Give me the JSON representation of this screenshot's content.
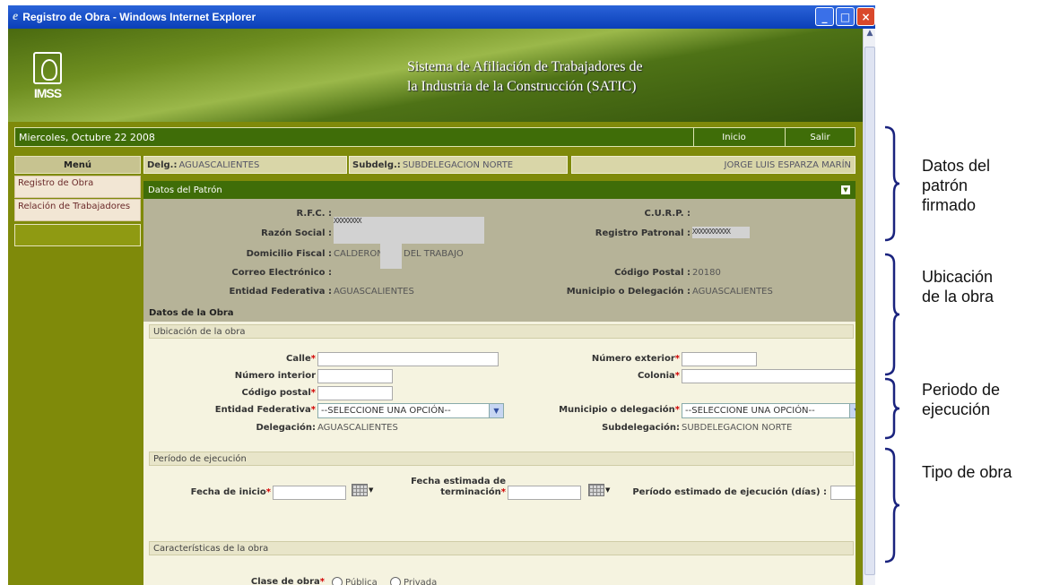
{
  "window": {
    "title": "Registro de Obra - Windows Internet Explorer"
  },
  "header": {
    "logo_text": "IMSS",
    "system_title_line1": "Sistema de Afiliación de Trabajadores de",
    "system_title_line2": "la Industria de la Construcción (SATIC)"
  },
  "topbar": {
    "date": "Miercoles, Octubre 22 2008",
    "inicio": "Inicio",
    "salir": "Salir"
  },
  "menu": {
    "title": "Menú",
    "items": [
      "Registro de Obra",
      "Relación de Trabajadores"
    ]
  },
  "info_bar": {
    "delg_label": "Delg.:",
    "delg_value": "AGUASCALIENTES",
    "subdelg_label": "Subdelg.:",
    "subdelg_value": "SUBDELEGACION NORTE",
    "user": "JORGE LUIS ESPARZA MARÍN"
  },
  "patron": {
    "section_title": "Datos del Patrón",
    "rfc_label": "R.F.C. :",
    "curp_label": "C.U.R.P. :",
    "razon_label": "Razón Social :",
    "razon_value": "XXXXXXXX",
    "registro_label": "Registro Patronal :",
    "registro_value": "XXXXXXXXXXX",
    "domicilio_label": "Domicilio Fiscal :",
    "domicilio_value_1": "CALDERON",
    "domicilio_value_2": "DEL TRABAJO",
    "correo_label": "Correo Electrónico :",
    "cp_label": "Código Postal :",
    "cp_value": "20180",
    "entidad_label": "Entidad Federativa :",
    "entidad_value": "AGUASCALIENTES",
    "municipio_label": "Municipio o Delegación :",
    "municipio_value": "AGUASCALIENTES"
  },
  "obra": {
    "section_title": "Datos de la Obra",
    "ubicacion_title": "Ubicación de la obra",
    "calle": "Calle",
    "num_ext": "Número exterior",
    "num_int": "Número interior",
    "colonia": "Colonia",
    "cp": "Código postal",
    "entidad": "Entidad Federativa",
    "municipio": "Municipio o delegación",
    "select_placeholder": "--SELECCIONE UNA OPCIÓN--",
    "delegacion_label": "Delegación:",
    "delegacion_value": "AGUASCALIENTES",
    "subdelegacion_label": "Subdelegación:",
    "subdelegacion_value": "SUBDELEGACION NORTE",
    "periodo_title": "Período de ejecución",
    "fecha_inicio": "Fecha de inicio",
    "fecha_term_1": "Fecha estimada de",
    "fecha_term_2": "terminación",
    "periodo_dias": "Período estimado de ejecución (días) :",
    "caracteristicas_title": "Características de la obra",
    "clase_label": "Clase de obra",
    "publica": "Pública",
    "privada": "Privada"
  },
  "annotations": {
    "a1": [
      "Datos del",
      "patrón",
      "firmado"
    ],
    "a2": [
      "Ubicación",
      "de la obra"
    ],
    "a3": [
      "Periodo de",
      "ejecución"
    ],
    "a4": [
      "Tipo de obra"
    ]
  },
  "colors": {
    "frame": "#7f8a0a",
    "bar": "#3f6d08",
    "required": "#d20000"
  },
  "icons": [
    "ie-icon",
    "minimize-icon",
    "maximize-icon",
    "close-icon",
    "calendar-icon",
    "chevron-down-icon"
  ]
}
